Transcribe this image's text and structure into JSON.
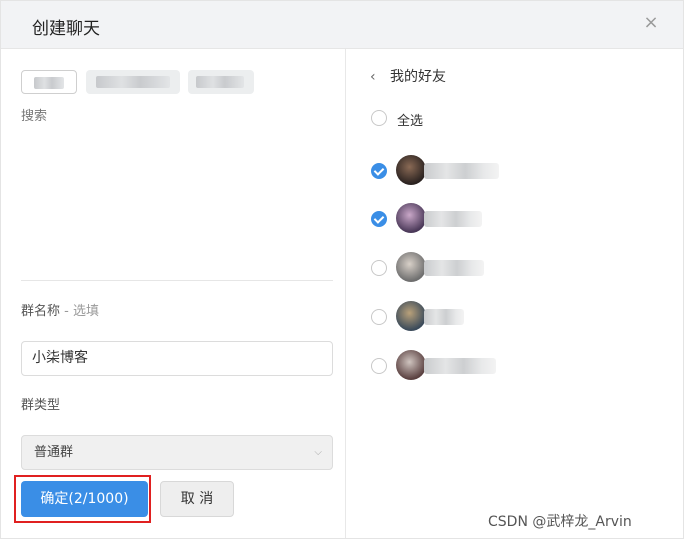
{
  "dialog": {
    "title": "创建聊天",
    "close_icon": "×"
  },
  "left": {
    "selected_chips": [
      "blurred-contact-1",
      "blurred-contact-2",
      "blurred-contact-3"
    ],
    "search_label": "搜索",
    "group_name_label": "群名称",
    "group_name_optional": " - 选填",
    "group_name_value": "小柒博客",
    "group_type_label": "群类型",
    "group_type_value": "普通群",
    "confirm_label": "确定(2/1000)",
    "cancel_label": "取 消"
  },
  "right": {
    "back_chevron": "‹",
    "friends_title": "我的好友",
    "select_all_label": "全选",
    "friends": [
      {
        "checked": true,
        "avatar_colors": [
          "#2a2220",
          "#8a6a55"
        ]
      },
      {
        "checked": true,
        "avatar_colors": [
          "#4a3858",
          "#c9a7c8"
        ]
      },
      {
        "checked": false,
        "avatar_colors": [
          "#6e6e6e",
          "#d8d0c8"
        ]
      },
      {
        "checked": false,
        "avatar_colors": [
          "#3a4a5a",
          "#b9a17a"
        ]
      },
      {
        "checked": false,
        "avatar_colors": [
          "#5a4040",
          "#cfc4bf"
        ]
      }
    ]
  },
  "colors": {
    "primary": "#3a8ee6",
    "highlight": "#e02020",
    "header_bg": "#f2f3f5"
  },
  "watermark": "CSDN @武梓龙_Arvin"
}
